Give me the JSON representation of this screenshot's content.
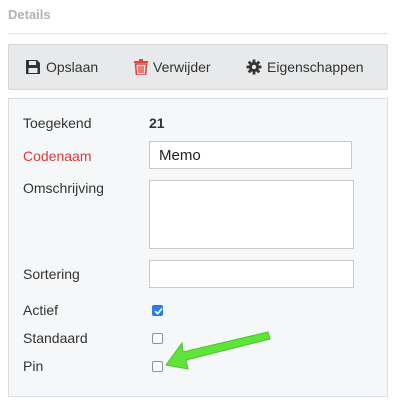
{
  "section": {
    "title": "Details"
  },
  "toolbar": {
    "save_label": "Opslaan",
    "delete_label": "Verwijder",
    "properties_label": "Eigenschappen"
  },
  "form": {
    "assigned": {
      "label": "Toegekend",
      "value": "21"
    },
    "codename": {
      "label": "Codenaam",
      "value": "Memo"
    },
    "description": {
      "label": "Omschrijving",
      "value": ""
    },
    "sorting": {
      "label": "Sortering",
      "value": ""
    },
    "active": {
      "label": "Actief",
      "checked": true
    },
    "default": {
      "label": "Standaard",
      "checked": false
    },
    "pin": {
      "label": "Pin",
      "checked": false
    }
  },
  "colors": {
    "accent": "#2a7de1",
    "required_label": "#d93a3a",
    "delete_icon": "#e0443c",
    "annotation_arrow": "#5fe43c"
  },
  "icons": {
    "save": "floppy-disk-icon",
    "delete": "trash-icon",
    "properties": "gear-icon",
    "annotation": "green-arrow-annotation"
  }
}
